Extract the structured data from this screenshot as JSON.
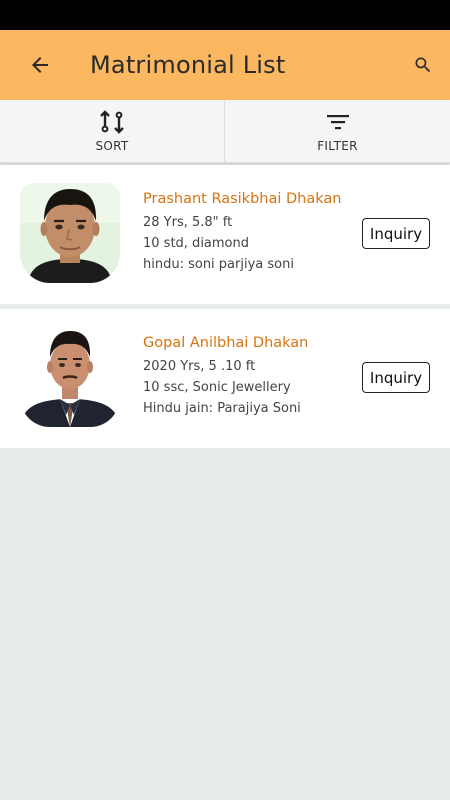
{
  "app_bar": {
    "title": "Matrimonial List",
    "back_icon": "arrow-left-icon",
    "search_icon": "search-icon",
    "color": "#fbb860"
  },
  "toolbar": {
    "sort_label": "SORT",
    "sort_icon": "swap-vertical-icon",
    "filter_label": "FILTER",
    "filter_icon": "filter-lines-icon"
  },
  "profiles": [
    {
      "name": "Prashant Rasikbhai Dhakan",
      "line1": "28 Yrs, 5.8\" ft",
      "line2": "10 std, diamond",
      "line3": "hindu: soni parjiya soni",
      "button": "Inquiry"
    },
    {
      "name": "Gopal Anilbhai Dhakan",
      "line1": "2020 Yrs, 5 .10 ft",
      "line2": "10 ssc, Sonic Jewellery",
      "line3": "Hindu jain: Parajiya Soni",
      "button": "Inquiry"
    }
  ],
  "colors": {
    "name_text": "#d8730f",
    "background": "#e8ebec"
  }
}
